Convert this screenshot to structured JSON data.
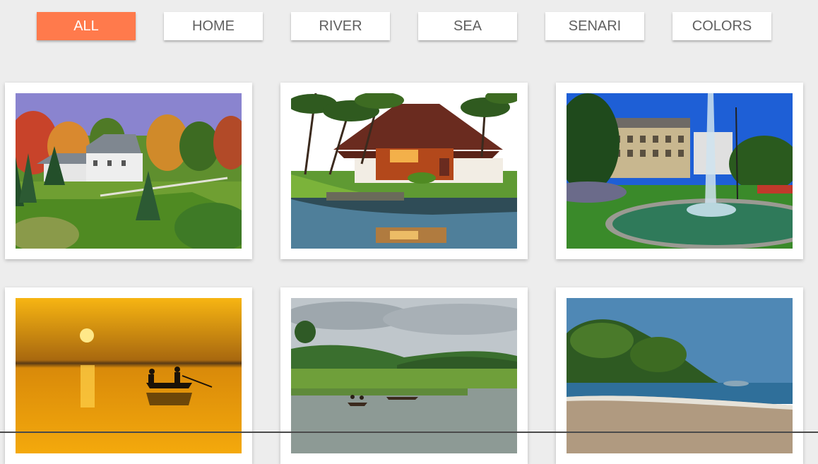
{
  "filters": [
    {
      "label": "ALL",
      "active": true
    },
    {
      "label": "HOME",
      "active": false
    },
    {
      "label": "RIVER",
      "active": false
    },
    {
      "label": "SEA",
      "active": false
    },
    {
      "label": "SENARI",
      "active": false
    },
    {
      "label": "COLORS",
      "active": false
    }
  ],
  "gallery": {
    "images": [
      {
        "subject": "country-house"
      },
      {
        "subject": "kerala-river-house"
      },
      {
        "subject": "city-fountain"
      },
      {
        "subject": "sunset-boat"
      },
      {
        "subject": "river-boats"
      },
      {
        "subject": "sea-beach"
      }
    ]
  },
  "colors": {
    "active_filter_bg": "#ff7a4c",
    "filter_bg": "#ffffff",
    "filter_text": "#606060",
    "page_bg": "#ededed"
  }
}
